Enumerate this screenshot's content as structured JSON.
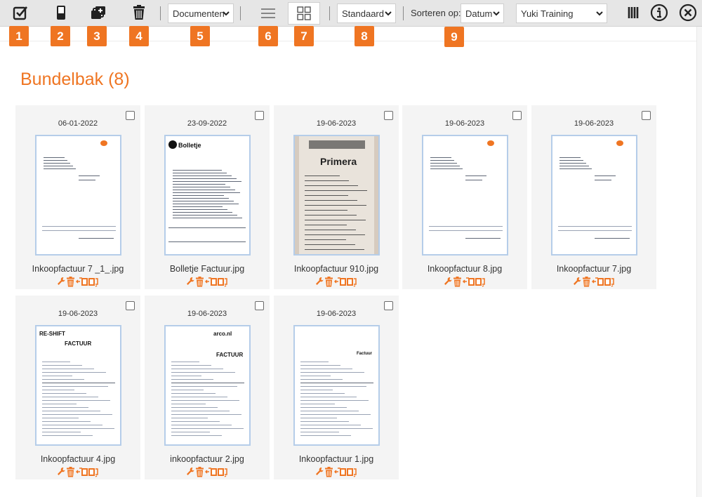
{
  "toolbar": {
    "document_type": "Documenten",
    "view_mode": "Standaard",
    "sort_label": "Sorteren op:",
    "sort_value": "Datum",
    "administration": "Yuki Training"
  },
  "badges": [
    "1",
    "2",
    "3",
    "4",
    "5",
    "6",
    "7",
    "8",
    "9"
  ],
  "page": {
    "title": "Bundelbak (8)"
  },
  "documents": [
    {
      "date": "06-01-2022",
      "filename": "Inkoopfactuur 7 _1_.jpg"
    },
    {
      "date": "23-09-2022",
      "filename": "Bolletje Factuur.jpg",
      "logo": "Bolletje"
    },
    {
      "date": "19-06-2023",
      "filename": "Inkoopfactuur 910.jpg",
      "logo": "Primera"
    },
    {
      "date": "19-06-2023",
      "filename": "Inkoopfactuur 8.jpg"
    },
    {
      "date": "19-06-2023",
      "filename": "Inkoopfactuur 7.jpg"
    },
    {
      "date": "19-06-2023",
      "filename": "Inkoopfactuur 4.jpg",
      "logo": "RE-SHIFT",
      "heading": "FACTUUR"
    },
    {
      "date": "19-06-2023",
      "filename": "inkoopfactuur 2.jpg",
      "logo": "arco.nl",
      "heading": "FACTUUR"
    },
    {
      "date": "19-06-2023",
      "filename": "Inkoopfactuur 1.jpg",
      "heading": "Factuur"
    }
  ],
  "colors": {
    "accent": "#ef7522",
    "toolbar_bg": "#e6e6e6",
    "card_bg": "#f4f4f4",
    "thumb_border": "#b5cde9"
  }
}
